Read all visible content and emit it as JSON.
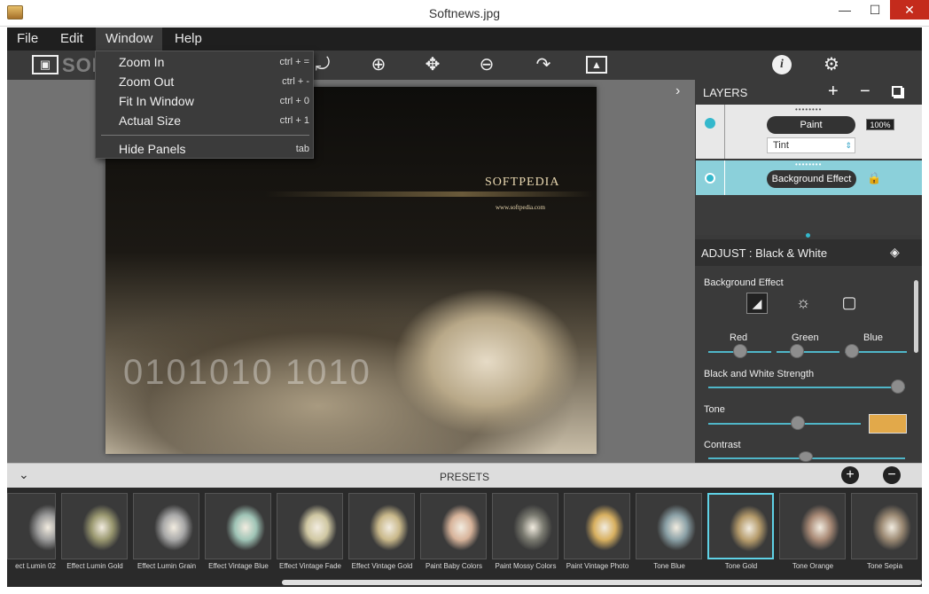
{
  "window": {
    "title": "Softnews.jpg",
    "minimize": "—",
    "maximize": "☐",
    "close": "✕"
  },
  "menubar": [
    "File",
    "Edit",
    "Window",
    "Help"
  ],
  "toolbar_icons": [
    "image-icon",
    "rotate-left-icon",
    "zoom-in-icon",
    "move-icon",
    "zoom-out-icon",
    "rotate-right-icon",
    "fit-image-icon",
    "info-icon",
    "settings-icon"
  ],
  "watermark": "SOFTPEDIA",
  "dropdown": {
    "items": [
      {
        "label": "Zoom In",
        "shortcut": "ctrl + ="
      },
      {
        "label": "Zoom Out",
        "shortcut": "ctrl + -"
      },
      {
        "label": "Fit In Window",
        "shortcut": "ctrl + 0"
      },
      {
        "label": "Actual Size",
        "shortcut": "ctrl + 1"
      },
      {
        "label": "Hide Panels",
        "shortcut": "tab"
      }
    ]
  },
  "photo": {
    "brand": "SOFTPEDIA",
    "url": "www.softpedia.com",
    "binary": "0101010 1010"
  },
  "layers": {
    "title": "LAYERS",
    "add": "+",
    "remove": "−",
    "layer1": {
      "name": "Paint",
      "opacity": "100%",
      "blend": "Tint"
    },
    "layer2": {
      "name": "Background Effect"
    }
  },
  "adjust": {
    "title": "ADJUST : Black & White",
    "section": "Background Effect",
    "channels": {
      "red": "Red",
      "green": "Green",
      "blue": "Blue"
    },
    "strength_label": "Black and White Strength",
    "tone_label": "Tone",
    "contrast_label": "Contrast",
    "tone_color": "#e2a94a",
    "accent": "#4fb6c8"
  },
  "presets": {
    "title": "PRESETS",
    "items": [
      {
        "label": "ect Lumin 02"
      },
      {
        "label": "Effect Lumin Gold"
      },
      {
        "label": "Effect Lumin Grain"
      },
      {
        "label": "Effect Vintage Blue"
      },
      {
        "label": "Effect Vintage Fade"
      },
      {
        "label": "Effect Vintage Gold"
      },
      {
        "label": "Paint Baby Colors"
      },
      {
        "label": "Paint Mossy Colors"
      },
      {
        "label": "Paint Vintage Photo"
      },
      {
        "label": "Tone Blue"
      },
      {
        "label": "Tone Gold",
        "selected": true
      },
      {
        "label": "Tone Orange"
      },
      {
        "label": "Tone Sepia"
      }
    ]
  }
}
